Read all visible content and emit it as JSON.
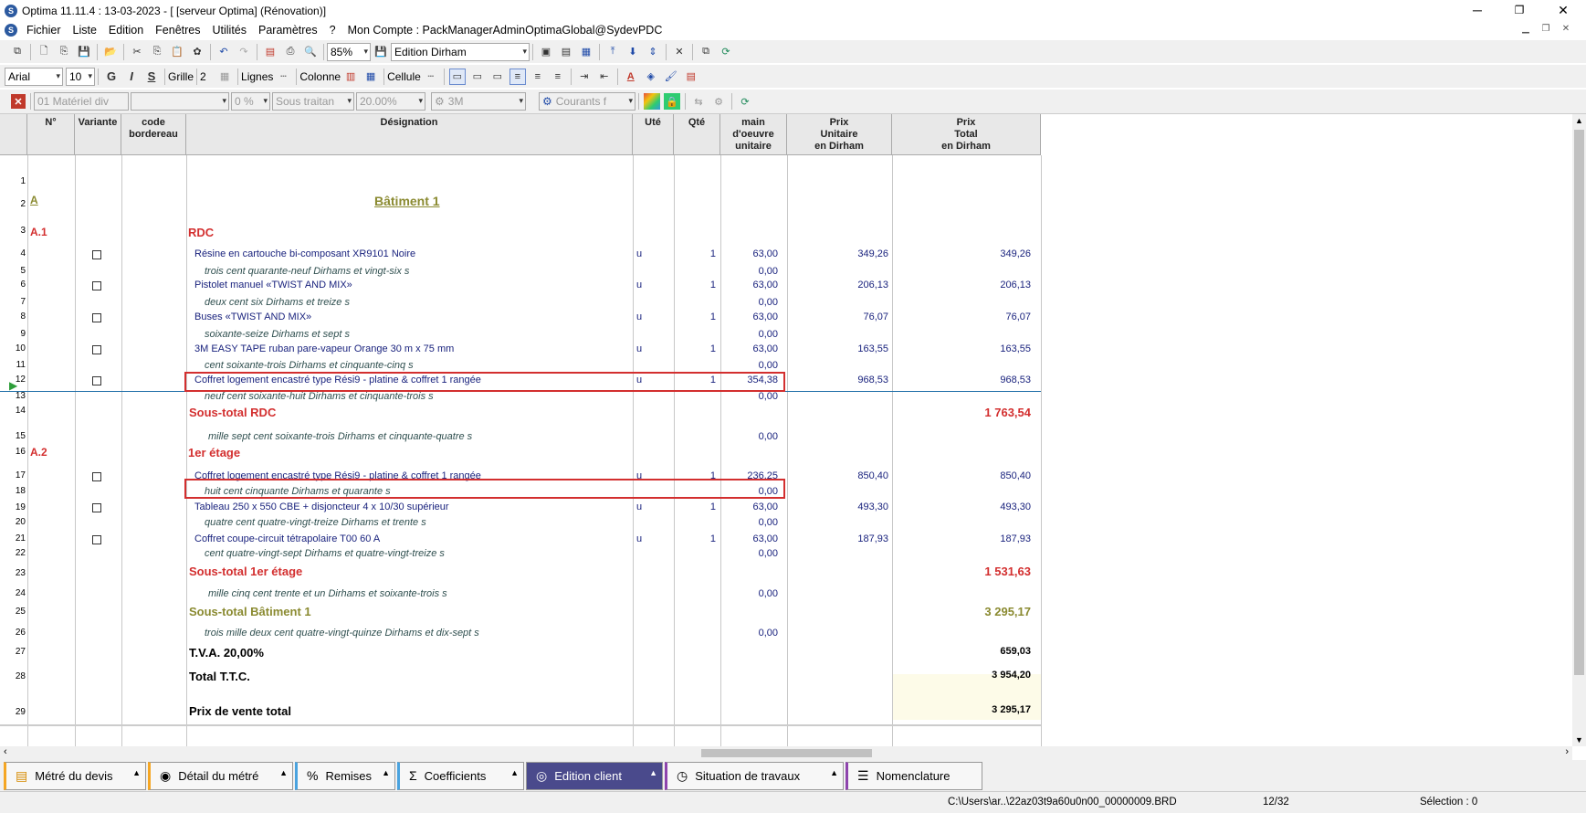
{
  "window": {
    "title": "Optima 11.11.4 : 13-03-2023 - [ [serveur Optima] (Rénovation)]",
    "minimize": "─",
    "restore": "❐",
    "close": "✕"
  },
  "menu": {
    "items": [
      "Fichier",
      "Liste",
      "Edition",
      "Fenêtres",
      "Utilités",
      "Paramètres",
      "?",
      "Mon Compte : PackManagerAdminOptimaGlobal@SydevPDC"
    ]
  },
  "toolbar1": {
    "zoom": "85%",
    "edition_mode": "Edition Dirham"
  },
  "toolbar2": {
    "font": "Arial",
    "font_size": "10",
    "bold": "G",
    "italic": "I",
    "underline": "S",
    "grid_label": "Grille",
    "grid_value": "2",
    "lines_label": "Lignes",
    "columns_label": "Colonne",
    "cell_label": "Cellule"
  },
  "toolbar3": {
    "lot": "01  Matériel div",
    "empty_combo": "",
    "percent": "0 %",
    "subcontract": "Sous traitan",
    "tva": "20.00%",
    "brand": "3M",
    "currency": "Courants f"
  },
  "grid": {
    "headers": {
      "num": "N°",
      "variante": "Variante",
      "code": "code\nbordereau",
      "designation": "Désignation",
      "ute": "Uté",
      "qte": "Qté",
      "main": "main\nd'oeuvre\nunitaire",
      "pu": "Prix\nUnitaire\nen Dirham",
      "pt": "Prix\nTotal\nen Dirham"
    },
    "rows": [
      {
        "n": "1"
      },
      {
        "n": "2",
        "num": "A",
        "des": "Bâtiment 1"
      },
      {
        "n": "3",
        "num": "A.1",
        "des": "RDC"
      },
      {
        "n": "4",
        "des": "Résine en cartouche bi-composant XR9101 Noire",
        "ute": "u",
        "qte": "1",
        "main": "63,00",
        "pu": "349,26",
        "pt": "349,26"
      },
      {
        "n": "5",
        "des": "trois cent quarante-neuf Dirhams et vingt-six s",
        "main": "0,00"
      },
      {
        "n": "6",
        "des": "Pistolet manuel «TWIST AND MIX»",
        "ute": "u",
        "qte": "1",
        "main": "63,00",
        "pu": "206,13",
        "pt": "206,13"
      },
      {
        "n": "7",
        "des": "deux cent six Dirhams et treize s",
        "main": "0,00"
      },
      {
        "n": "8",
        "des": "Buses «TWIST AND MIX»",
        "ute": "u",
        "qte": "1",
        "main": "63,00",
        "pu": "76,07",
        "pt": "76,07"
      },
      {
        "n": "9",
        "des": "soixante-seize Dirhams et sept s",
        "main": "0,00"
      },
      {
        "n": "10",
        "des": "3M EASY TAPE ruban pare-vapeur Orange 30 m x 75 mm",
        "ute": "u",
        "qte": "1",
        "main": "63,00",
        "pu": "163,55",
        "pt": "163,55"
      },
      {
        "n": "11",
        "des": "cent soixante-trois Dirhams et cinquante-cinq s",
        "main": "0,00"
      },
      {
        "n": "12",
        "des": "Coffret logement encastré type Rési9 - platine & coffret 1 rangée",
        "ute": "u",
        "qte": "1",
        "main": "354,38",
        "pu": "968,53",
        "pt": "968,53"
      },
      {
        "n": "13",
        "des": "neuf cent soixante-huit Dirhams et cinquante-trois s",
        "main": "0,00"
      },
      {
        "n": "14",
        "des": "Sous-total RDC",
        "pt": "1 763,54"
      },
      {
        "n": "15",
        "des": "mille sept cent soixante-trois Dirhams et cinquante-quatre s",
        "main": "0,00"
      },
      {
        "n": "16",
        "num": "A.2",
        "des": "1er étage"
      },
      {
        "n": "17",
        "des": "Coffret logement encastré type Rési9 - platine & coffret 1 rangée",
        "ute": "u",
        "qte": "1",
        "main": "236,25",
        "pu": "850,40",
        "pt": "850,40"
      },
      {
        "n": "18",
        "des": "huit cent cinquante Dirhams et quarante s",
        "main": "0,00"
      },
      {
        "n": "19",
        "des": "Tableau 250 x 550 CBE + disjoncteur 4 x 10/30 supérieur",
        "ute": "u",
        "qte": "1",
        "main": "63,00",
        "pu": "493,30",
        "pt": "493,30"
      },
      {
        "n": "20",
        "des": "quatre cent  quatre-vingt-treize Dirhams et trente s",
        "main": "0,00"
      },
      {
        "n": "21",
        "des": "Coffret coupe-circuit tétrapolaire T00 60 A",
        "ute": "u",
        "qte": "1",
        "main": "63,00",
        "pu": "187,93",
        "pt": "187,93"
      },
      {
        "n": "22",
        "des": "cent quatre-vingt-sept Dirhams et  quatre-vingt-treize s",
        "main": "0,00"
      },
      {
        "n": "23",
        "des": "Sous-total 1er étage",
        "pt": "1 531,63"
      },
      {
        "n": "24",
        "des": "mille cinq cent trente et un Dirhams et soixante-trois s",
        "main": "0,00"
      },
      {
        "n": "25",
        "des": "Sous-total Bâtiment 1",
        "pt": "3 295,17"
      },
      {
        "n": "26",
        "des": "trois mille deux cent  quatre-vingt-quinze Dirhams et dix-sept s",
        "main": "0,00"
      },
      {
        "n": "27",
        "des": "T.V.A. 20,00%",
        "pt": "659,03"
      },
      {
        "n": "28",
        "des": "Total  T.T.C.",
        "pt": "3 954,20"
      },
      {
        "n": "29",
        "des": "Prix de vente total",
        "pt": "3 295,17"
      }
    ]
  },
  "tabs": [
    {
      "label": "Métré du devis",
      "color": "#f5a623"
    },
    {
      "label": "Détail du métré",
      "color": "#f5a623"
    },
    {
      "label": "Remises",
      "color": "#4aa3df"
    },
    {
      "label": "Coefficients",
      "color": "#4aa3df"
    },
    {
      "label": "Edition client",
      "color": "#4a4a8c"
    },
    {
      "label": "Situation de travaux",
      "color": "#8e44ad"
    },
    {
      "label": "Nomenclature",
      "color": "#8e44ad"
    }
  ],
  "status": {
    "path": "C:\\Users\\ar..\\22az03t9a60u0n00_00000009.BRD",
    "position": "12/32",
    "selection": "Sélection : 0"
  }
}
